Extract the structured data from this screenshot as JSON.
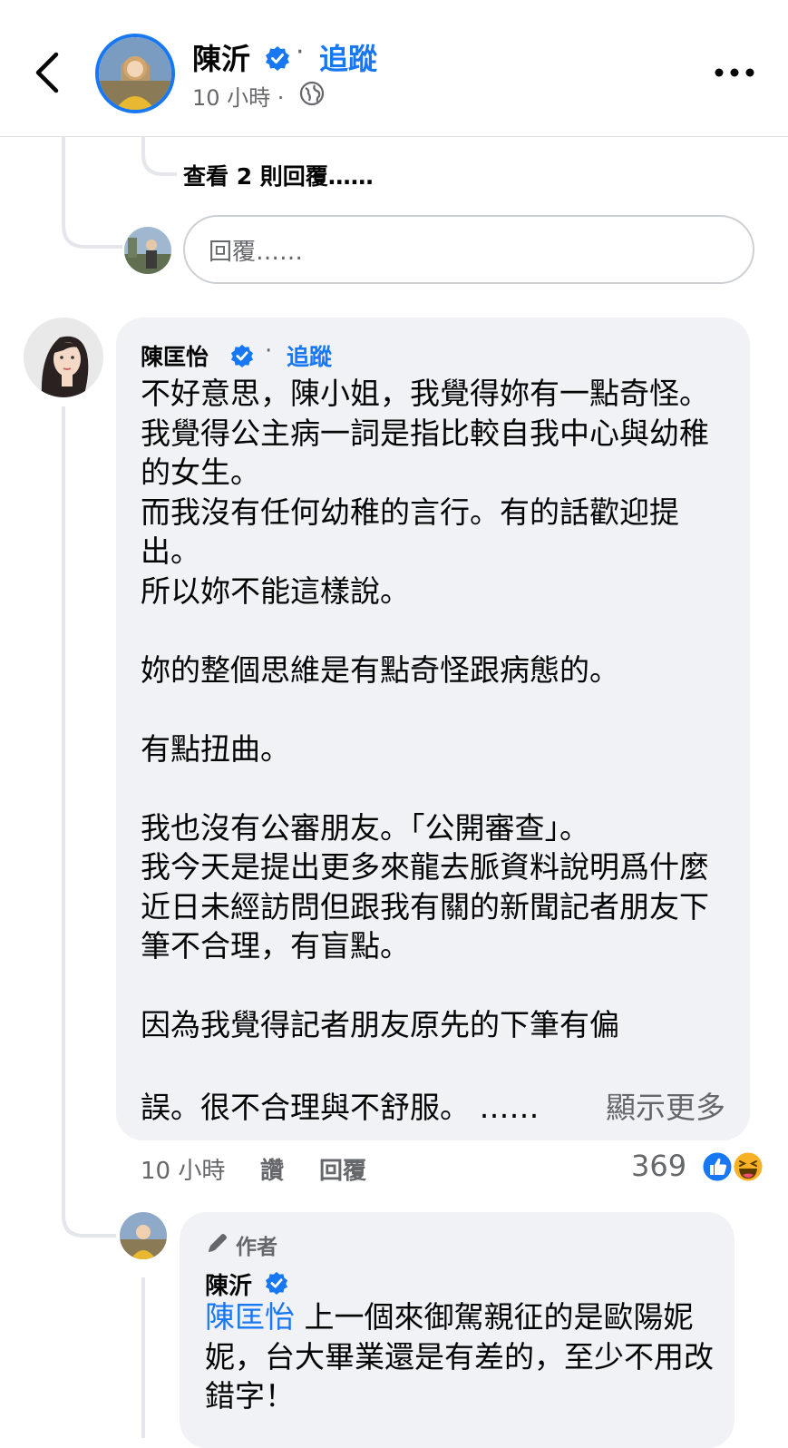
{
  "header": {
    "name": "陳沂",
    "dot": "·",
    "follow": "追蹤",
    "time": "10 小時 ·"
  },
  "thread": {
    "view_replies": "查看 2 則回覆……",
    "reply_placeholder": "回覆……"
  },
  "comment1": {
    "name": "陳匡怡",
    "dot": "·",
    "follow": "追蹤",
    "text": "不好意思，陳小姐，我覺得妳有一點奇怪。\n我覺得公主病一詞是指比較自我中心與幼稚的女生。\n而我沒有任何幼稚的言行。有的話歡迎提出。\n所以妳不能這樣說。\n\n妳的整個思維是有點奇怪跟病態的。\n\n有點扭曲。\n\n我也沒有公審朋友。「公開審查」。\n我今天是提出更多來龍去脈資料說明爲什麼近日未經訪問但跟我有關的新聞記者朋友下筆不合理，有盲點。\n\n因為我覺得記者朋友原先的下筆有偏",
    "text_last": "誤。很不合理與不舒服。 ……",
    "show_more": "顯示更多",
    "time": "10 小時",
    "like": "讚",
    "reply": "回覆",
    "reaction_count": "369",
    "reaction_icons": [
      "like-reaction-icon",
      "haha-reaction-icon"
    ]
  },
  "comment2": {
    "author_badge": "作者",
    "name": "陳沂",
    "mention": "陳匡怡",
    "text": " 上一個來御駕親征的是歐陽妮妮，台大畢業還是有差的，至少不用改錯字！"
  },
  "colors": {
    "accent": "#1877f2",
    "bubble": "#f0f2f5",
    "secondary_text": "#65676b"
  }
}
